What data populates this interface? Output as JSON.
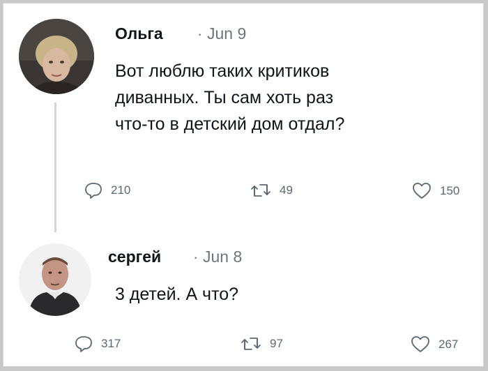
{
  "tweets": [
    {
      "author": "Ольга",
      "separator": "·",
      "date": "Jun 9",
      "lines": [
        "Вот люблю таких критиков",
        "диванных. Ты сам хоть раз",
        "что-то в детский дом отдал?"
      ],
      "replies": "210",
      "retweets": "49",
      "likes": "150"
    },
    {
      "author": "сергей",
      "separator": "·",
      "date": "Jun 8",
      "lines": [
        "3 детей. А что?"
      ],
      "replies": "317",
      "retweets": "97",
      "likes": "267"
    }
  ],
  "colors": {
    "text": "#0f1419",
    "muted": "#6e767d",
    "thread_line": "#cfd6db"
  },
  "icons": [
    "reply-icon",
    "retweet-icon",
    "like-icon"
  ]
}
